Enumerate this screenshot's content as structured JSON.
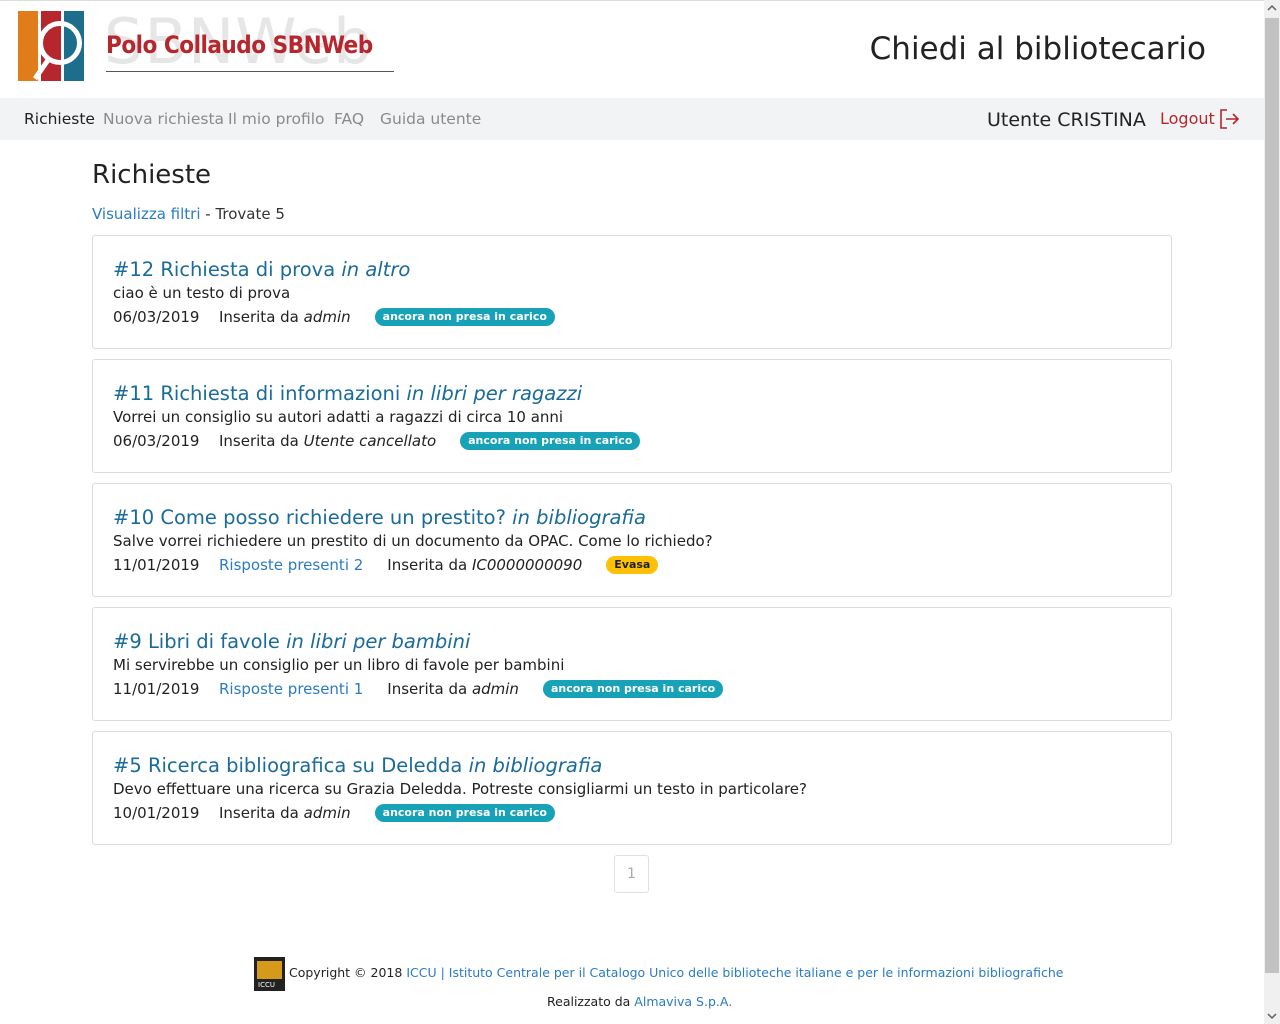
{
  "header": {
    "brand": "Polo Collaudo SBNWeb",
    "brand_ghost": "SBNWeb",
    "site_title": "Chiedi al bibliotecario"
  },
  "nav": {
    "items": [
      {
        "label": "Richieste",
        "active": true
      },
      {
        "label": "Nuova richiesta",
        "active": false
      },
      {
        "label": "Il mio profilo",
        "active": false
      },
      {
        "label": "FAQ",
        "active": false
      },
      {
        "label": "Guida utente",
        "active": false
      }
    ],
    "user": "Utente CRISTINA",
    "logout": "Logout"
  },
  "main": {
    "title": "Richieste",
    "filters_link": "Visualizza filtri",
    "found_text": " - Trovate 5"
  },
  "requests": [
    {
      "title": "#12 Richiesta di prova",
      "category": "in altro",
      "description": "ciao è un testo di prova",
      "date": "06/03/2019",
      "replies": "",
      "inserted_label": "Inserita da ",
      "author": "admin",
      "status": "ancora non presa in carico",
      "status_color": "#17a2b8"
    },
    {
      "title": "#11 Richiesta di informazioni",
      "category": "in libri per ragazzi",
      "description": "Vorrei un consiglio su autori adatti a ragazzi di circa 10 anni",
      "date": "06/03/2019",
      "replies": "",
      "inserted_label": "Inserita da ",
      "author": "Utente cancellato",
      "status": "ancora non presa in carico",
      "status_color": "#17a2b8"
    },
    {
      "title": "#10 Come posso richiedere un prestito?",
      "category": "in bibliografia",
      "description": "Salve vorrei richiedere un prestito di un documento da OPAC. Come lo richiedo?",
      "date": "11/01/2019",
      "replies": "Risposte presenti 2",
      "inserted_label": "Inserita da ",
      "author": "IC0000000090",
      "status": "Evasa",
      "status_color": "#ffc107"
    },
    {
      "title": "#9 Libri di favole",
      "category": "in libri per bambini",
      "description": "Mi servirebbe un consiglio per un libro di favole per bambini",
      "date": "11/01/2019",
      "replies": "Risposte presenti 1",
      "inserted_label": "Inserita da ",
      "author": "admin",
      "status": "ancora non presa in carico",
      "status_color": "#17a2b8"
    },
    {
      "title": "#5 Ricerca bibliografica su Deledda",
      "category": "in bibliografia",
      "description": "Devo effettuare una ricerca su Grazia Deledda. Potreste consigliarmi un testo in particolare?",
      "date": "10/01/2019",
      "replies": "",
      "inserted_label": "Inserita da ",
      "author": "admin",
      "status": "ancora non presa in carico",
      "status_color": "#17a2b8"
    }
  ],
  "pagination": {
    "current_page": "1"
  },
  "footer": {
    "copyright_prefix": "Copyright © 2018 ",
    "iccu_link": "ICCU | Istituto Centrale per il Catalogo Unico delle biblioteche italiane e per le informazioni bibliografiche",
    "made_by_prefix": "Realizzato da ",
    "made_by_link": "Almaviva S.p.A.",
    "icon_text": "ICCU"
  }
}
